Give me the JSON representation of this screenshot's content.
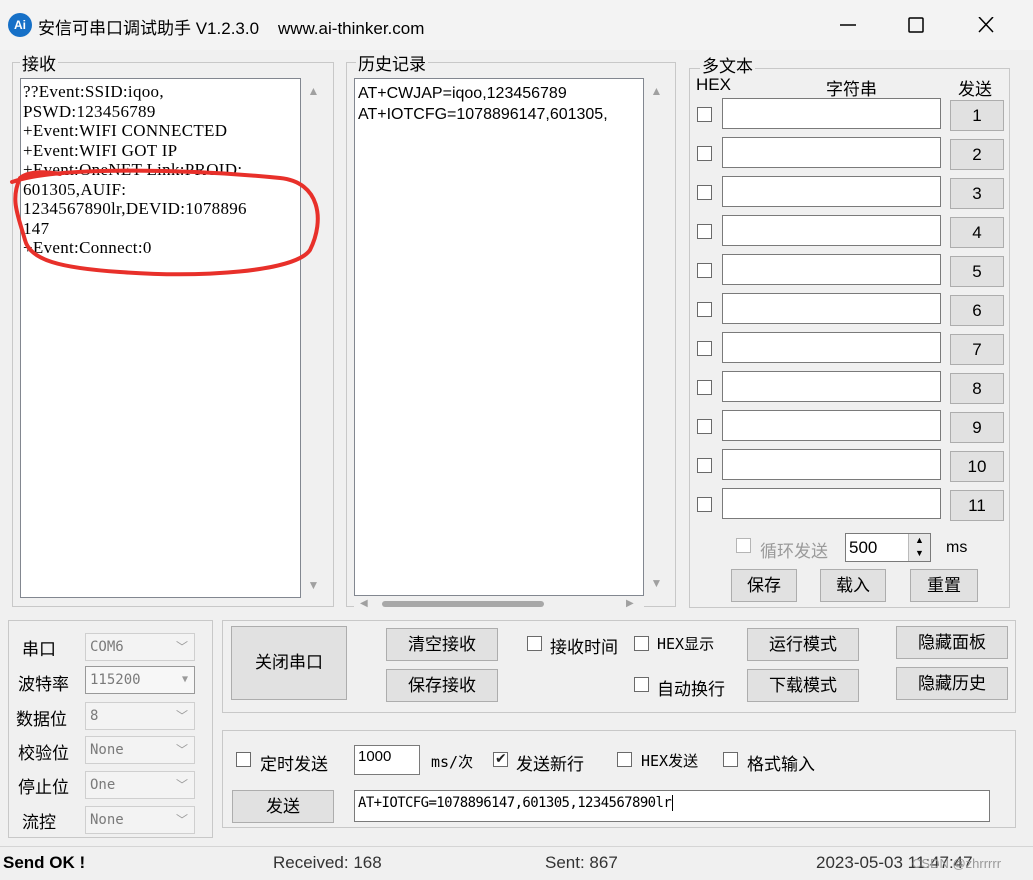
{
  "window": {
    "logo_text": "Ai",
    "title": "安信可串口调试助手 V1.2.3.0    www.ai-thinker.com",
    "minimize_glyph": "—",
    "maximize_glyph": "☐",
    "close_glyph": "✕"
  },
  "receive": {
    "label": "接收",
    "lines": [
      "??Event:SSID:iqoo,",
      "PSWD:123456789",
      "+Event:WIFI CONNECTED",
      "+Event:WIFI GOT IP",
      "+Event:OneNET Link:PROID:",
      "601305,AUIF:",
      "1234567890lr,DEVID:1078896",
      "147",
      "+Event:Connect:0"
    ]
  },
  "history": {
    "label": "历史记录",
    "lines": [
      "AT+CWJAP=iqoo,123456789",
      "AT+IOTCFG=1078896147,601305,"
    ]
  },
  "multitext": {
    "label": "多文本",
    "col_hex": "HEX",
    "col_string": "字符串",
    "col_send": "发送",
    "rows": [
      {
        "button": "1",
        "value": ""
      },
      {
        "button": "2",
        "value": ""
      },
      {
        "button": "3",
        "value": ""
      },
      {
        "button": "4",
        "value": ""
      },
      {
        "button": "5",
        "value": ""
      },
      {
        "button": "6",
        "value": ""
      },
      {
        "button": "7",
        "value": ""
      },
      {
        "button": "8",
        "value": ""
      },
      {
        "button": "9",
        "value": ""
      },
      {
        "button": "10",
        "value": ""
      },
      {
        "button": "11",
        "value": ""
      }
    ],
    "loop_send_label": "循环发送",
    "loop_interval": "500",
    "loop_unit": "ms",
    "save_label": "保存",
    "load_label": "载入",
    "reset_label": "重置"
  },
  "serial": {
    "port_label": "串口",
    "port_value": "COM6",
    "baud_label": "波特率",
    "baud_value": "115200",
    "databits_label": "数据位",
    "databits_value": "8",
    "parity_label": "校验位",
    "parity_value": "None",
    "stopbits_label": "停止位",
    "stopbits_value": "One",
    "flow_label": "流控",
    "flow_value": "None"
  },
  "controls": {
    "close_port_label": "关闭串口",
    "clear_receive_label": "清空接收",
    "save_receive_label": "保存接收",
    "receive_time_label": "接收时间",
    "hex_display_label": "HEX显示",
    "auto_newline_label": "自动换行",
    "run_mode_label": "运行模式",
    "download_mode_label": "下载模式",
    "hide_panel_label": "隐藏面板",
    "hide_history_label": "隐藏历史"
  },
  "send": {
    "timed_send_label": "定时发送",
    "interval_value": "1000",
    "interval_unit": "ms/次",
    "send_newline_label": "发送新行",
    "hex_send_label": "HEX发送",
    "format_input_label": "格式输入",
    "send_button_label": "发送",
    "send_text": "AT+IOTCFG=1078896147,601305,1234567890lr"
  },
  "status": {
    "send_status": "Send OK !",
    "received": "Received: 168",
    "sent": "Sent: 867",
    "datetime": "2023-05-03 11:47:47",
    "watermark": "CSDN @zhrrrrr"
  }
}
